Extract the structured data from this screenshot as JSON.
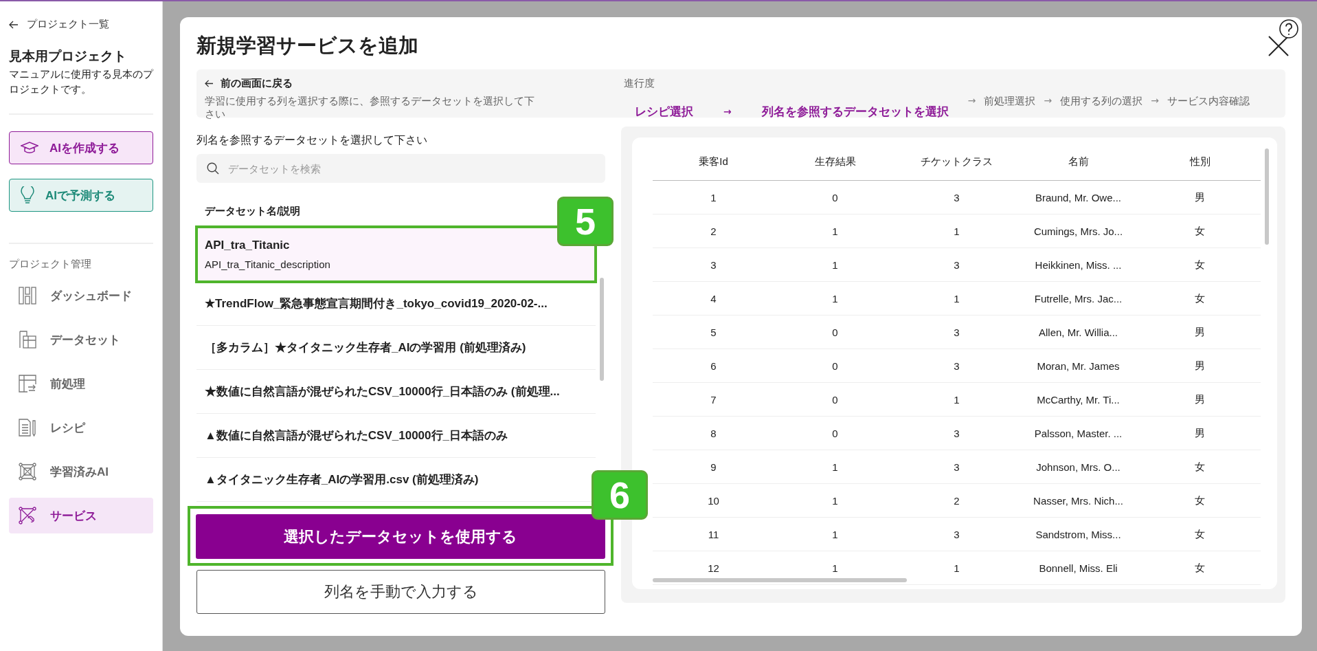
{
  "sidebar": {
    "back_link": "プロジェクト一覧",
    "project_name": "見本用プロジェクト",
    "project_description": "マニュアルに使用する見本のプロジェクトです。",
    "actions": [
      {
        "label": "AIを作成する",
        "kind": "create"
      },
      {
        "label": "AIで予測する",
        "kind": "predict"
      }
    ],
    "section_title": "プロジェクト管理",
    "nav": [
      {
        "label": "ダッシュボード",
        "kind": "dashboard",
        "selected": false
      },
      {
        "label": "データセット",
        "kind": "dataset",
        "selected": false
      },
      {
        "label": "前処理",
        "kind": "preprocess",
        "selected": false
      },
      {
        "label": "レシピ",
        "kind": "recipe",
        "selected": false
      },
      {
        "label": "学習済みAI",
        "kind": "model",
        "selected": false
      },
      {
        "label": "サービス",
        "kind": "service",
        "selected": true
      }
    ]
  },
  "dialog": {
    "title": "新規学習サービスを追加",
    "back": {
      "label": "前の画面に戻る",
      "hint": "学習に使用する列を選択する際に、参照するデータセットを選択して下さい"
    },
    "progress": {
      "title": "進行度",
      "separator": "→",
      "steps": [
        {
          "label": "レシピ選択",
          "active": true
        },
        {
          "label": "列名を参照するデータセットを選択",
          "active": true
        },
        {
          "label": "前処理選択",
          "active": false
        },
        {
          "label": "使用する列の選択",
          "active": false
        },
        {
          "label": "サービス内容確認",
          "active": false
        }
      ]
    },
    "dataset_picker": {
      "label": "列名を参照するデータセットを選択して下さい",
      "search": {
        "placeholder": "データセットを検索"
      },
      "column_heading": "データセット名/説明",
      "datasets": [
        {
          "name": "API_tra_Titanic",
          "description": "API_tra_Titanic_description",
          "selected": true,
          "callout": "5"
        },
        {
          "name": "★TrendFlow_緊急事態宣言期間付き_tokyo_covid19_2020-02-...",
          "selected": false
        },
        {
          "name": "［多カラム］★タイタニック生存者_AIの学習用 (前処理済み)",
          "selected": false
        },
        {
          "name": "★数値に自然言語が混ぜられたCSV_10000行_日本語のみ (前処理...",
          "selected": false
        },
        {
          "name": "▲数値に自然言語が混ぜられたCSV_10000行_日本語のみ",
          "selected": false
        },
        {
          "name": "▲タイタニック生存者_AIの学習用.csv (前処理済み)",
          "selected": false
        }
      ],
      "primary_button": {
        "label": "選択したデータセットを使用する",
        "callout": "6"
      },
      "secondary_button": "列名を手動で入力する"
    },
    "preview_table": {
      "columns": [
        "乗客Id",
        "生存結果",
        "チケットクラス",
        "名前",
        "性別"
      ],
      "rows": [
        [
          "1",
          "0",
          "3",
          "Braund, Mr. Owe...",
          "男"
        ],
        [
          "2",
          "1",
          "1",
          "Cumings, Mrs. Jo...",
          "女"
        ],
        [
          "3",
          "1",
          "3",
          "Heikkinen, Miss. ...",
          "女"
        ],
        [
          "4",
          "1",
          "1",
          "Futrelle, Mrs. Jac...",
          "女"
        ],
        [
          "5",
          "0",
          "3",
          "Allen, Mr. Willia...",
          "男"
        ],
        [
          "6",
          "0",
          "3",
          "Moran, Mr. James",
          "男"
        ],
        [
          "7",
          "0",
          "1",
          "McCarthy, Mr. Ti...",
          "男"
        ],
        [
          "8",
          "0",
          "3",
          "Palsson, Master. ...",
          "男"
        ],
        [
          "9",
          "1",
          "3",
          "Johnson, Mrs. O...",
          "女"
        ],
        [
          "10",
          "1",
          "2",
          "Nasser, Mrs. Nich...",
          "女"
        ],
        [
          "11",
          "1",
          "3",
          "Sandstrom, Miss...",
          "女"
        ],
        [
          "12",
          "1",
          "1",
          "Bonnell, Miss. Eli",
          "女"
        ]
      ]
    }
  }
}
